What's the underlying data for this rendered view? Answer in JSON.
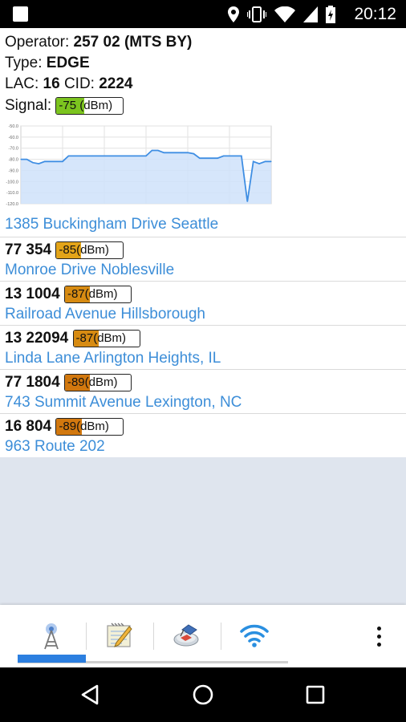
{
  "status_bar": {
    "time": "20:12",
    "icons": [
      "notification-square-icon",
      "location-pin-icon",
      "vibrate-icon",
      "wifi-icon",
      "cell-signal-icon",
      "battery-charging-icon"
    ]
  },
  "operator": {
    "label": "Operator:",
    "value": "257 02 (MTS BY)"
  },
  "type": {
    "label": "Type:",
    "value": "EDGE"
  },
  "lac": {
    "label": "LAC:",
    "value": "16"
  },
  "cid": {
    "label": "CID:",
    "value": "2224"
  },
  "signal": {
    "label": "Signal:",
    "value": "-75",
    "unit": "(dBm)",
    "color": "#7cc41f",
    "fill_fraction": 0.42
  },
  "chart_data": {
    "type": "line",
    "y_ticks": [
      "-50.0",
      "-60.0",
      "-70.0",
      "-80.0",
      "-90.0",
      "-100.0",
      "-110.0",
      "-120.0"
    ],
    "ylim": [
      -120,
      -50
    ],
    "grid": true,
    "line_color": "#3f8ee3",
    "area_color": "#cfe2fa",
    "values": [
      -80,
      -80,
      -83,
      -84,
      -82,
      -82,
      -82,
      -82,
      -77,
      -77,
      -77,
      -77,
      -77,
      -77,
      -77,
      -77,
      -77,
      -77,
      -77,
      -77,
      -77,
      -77,
      -72,
      -72,
      -74,
      -74,
      -74,
      -74,
      -74,
      -75,
      -79,
      -79,
      -79,
      -79,
      -77,
      -77,
      -77,
      -77,
      -118,
      -82,
      -84,
      -82,
      -82
    ]
  },
  "current_address": "1385 Buckingham Drive Seattle",
  "neighbors": [
    {
      "cell": "77 354",
      "signal": "-85",
      "unit": "(dBm)",
      "color": "#e3a418",
      "fill_fraction": 0.37,
      "address": "Monroe Drive Noblesville"
    },
    {
      "cell": "13 1004",
      "signal": "-87",
      "unit": "(dBm)",
      "color": "#d78b12",
      "fill_fraction": 0.38,
      "address": "Railroad Avenue Hillsborough"
    },
    {
      "cell": "13 22094",
      "signal": "-87",
      "unit": "(dBm)",
      "color": "#d78b12",
      "fill_fraction": 0.38,
      "address": "Linda Lane Arlington Heights, IL"
    },
    {
      "cell": "77 1804",
      "signal": "-89",
      "unit": "(dBm)",
      "color": "#d2780e",
      "fill_fraction": 0.38,
      "address": "743 Summit Avenue Lexington, NC"
    },
    {
      "cell": "16 804",
      "signal": "-89",
      "unit": "(dBm)",
      "color": "#d2780e",
      "fill_fraction": 0.38,
      "address": "963 Route 202"
    }
  ],
  "tabs": [
    {
      "icon": "cell-tower-icon",
      "selected": true
    },
    {
      "icon": "notepad-pencil-icon",
      "selected": false
    },
    {
      "icon": "compass-map-icon",
      "selected": false
    },
    {
      "icon": "wifi-icon",
      "selected": false
    }
  ],
  "nav": [
    "back-icon",
    "home-icon",
    "recents-icon"
  ]
}
